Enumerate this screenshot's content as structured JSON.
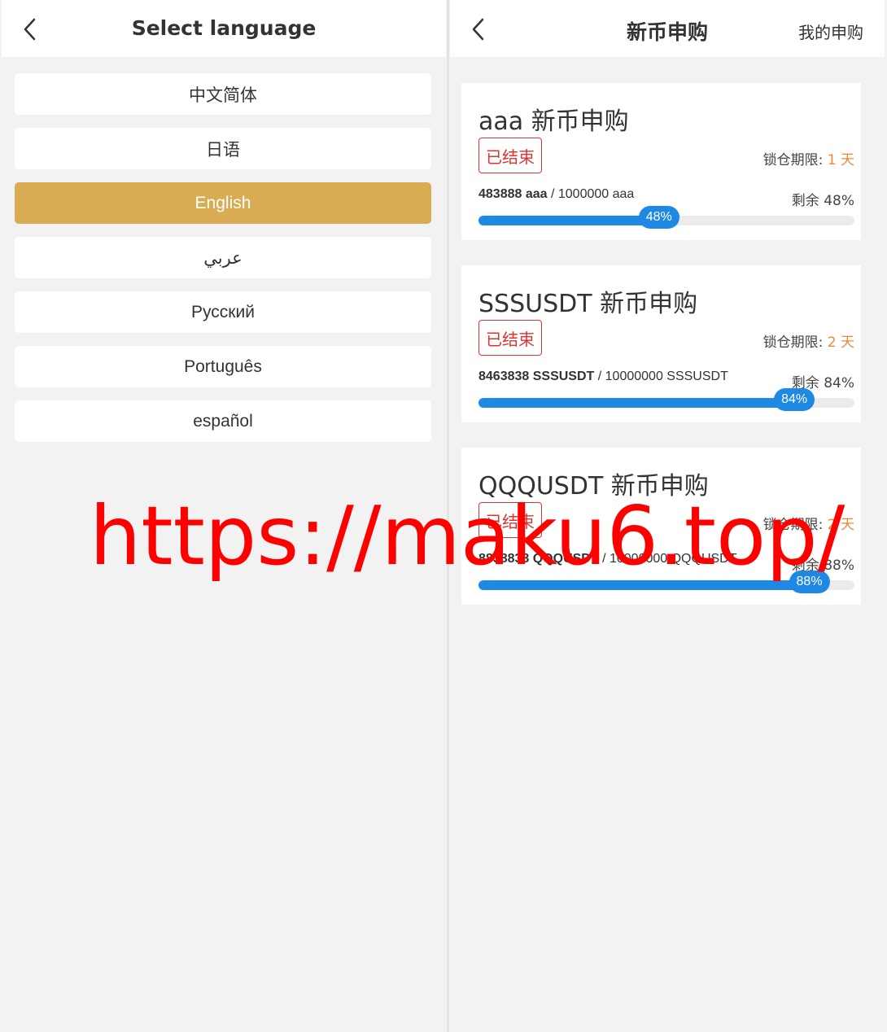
{
  "language_screen": {
    "title": "Select language",
    "items": [
      {
        "label": "中文简体",
        "active": false
      },
      {
        "label": "日语",
        "active": false
      },
      {
        "label": "English",
        "active": true
      },
      {
        "label": "عربي",
        "active": false
      },
      {
        "label": "Русский",
        "active": false
      },
      {
        "label": "Português",
        "active": false
      },
      {
        "label": "español",
        "active": false
      }
    ]
  },
  "ipo_screen": {
    "title": "新币申购",
    "my_subscriptions": "我的申购",
    "lock_label": "锁仓期限:",
    "remaining_label": "剩余",
    "cards": [
      {
        "title": "aaa 新币申购",
        "status": "已结束",
        "lock_value": "1 天",
        "sold": "483888 aaa",
        "total": "1000000 aaa",
        "percent": 48
      },
      {
        "title": "SSSUSDT 新币申购",
        "status": "已结束",
        "lock_value": "2 天",
        "sold": "8463838 SSSUSDT",
        "total": "10000000 SSSUSDT",
        "percent": 84
      },
      {
        "title": "QQQUSDT 新币申购",
        "status": "已结束",
        "lock_value": "2 天",
        "sold": "8838838 QQQUSDT",
        "total": "10000000 QQQUSDT",
        "percent": 88
      }
    ]
  },
  "watermark": "https://maku6.top/",
  "colors": {
    "accent_gold": "#d9ab52",
    "progress_blue": "#1e88e5",
    "status_red": "#dd3333",
    "lock_orange": "#e8893a"
  },
  "icons": {
    "back": "chevron-left-icon"
  }
}
